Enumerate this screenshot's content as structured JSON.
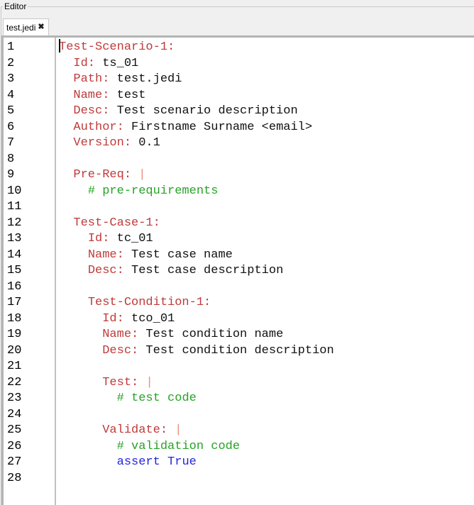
{
  "groupbox": {
    "title": "Editor"
  },
  "tabs": [
    {
      "label": "test.jedi",
      "close_icon": "close-icon",
      "active": true
    }
  ],
  "colors": {
    "key": "#c03a3a",
    "value": "#111111",
    "comment": "#26a326",
    "pipe": "#e8907a",
    "keyword": "#2424e0"
  },
  "editor": {
    "lines": [
      {
        "n": "1",
        "tokens": [
          {
            "t": "key",
            "s": "Test-Scenario-1:"
          }
        ],
        "caret": true
      },
      {
        "n": "2",
        "tokens": [
          {
            "t": "ws",
            "s": "  "
          },
          {
            "t": "key",
            "s": "Id:"
          },
          {
            "t": "val",
            "s": " ts_01"
          }
        ]
      },
      {
        "n": "3",
        "tokens": [
          {
            "t": "ws",
            "s": "  "
          },
          {
            "t": "key",
            "s": "Path:"
          },
          {
            "t": "val",
            "s": " test.jedi"
          }
        ]
      },
      {
        "n": "4",
        "tokens": [
          {
            "t": "ws",
            "s": "  "
          },
          {
            "t": "key",
            "s": "Name:"
          },
          {
            "t": "val",
            "s": " test"
          }
        ]
      },
      {
        "n": "5",
        "tokens": [
          {
            "t": "ws",
            "s": "  "
          },
          {
            "t": "key",
            "s": "Desc:"
          },
          {
            "t": "val",
            "s": " Test scenario description"
          }
        ]
      },
      {
        "n": "6",
        "tokens": [
          {
            "t": "ws",
            "s": "  "
          },
          {
            "t": "key",
            "s": "Author:"
          },
          {
            "t": "val",
            "s": " Firstname Surname <email>"
          }
        ]
      },
      {
        "n": "7",
        "tokens": [
          {
            "t": "ws",
            "s": "  "
          },
          {
            "t": "key",
            "s": "Version:"
          },
          {
            "t": "val",
            "s": " 0.1"
          }
        ]
      },
      {
        "n": "8",
        "tokens": []
      },
      {
        "n": "9",
        "tokens": [
          {
            "t": "ws",
            "s": "  "
          },
          {
            "t": "key",
            "s": "Pre-Req:"
          },
          {
            "t": "ws",
            "s": " "
          },
          {
            "t": "pipe",
            "s": "|"
          }
        ]
      },
      {
        "n": "10",
        "tokens": [
          {
            "t": "ws",
            "s": "    "
          },
          {
            "t": "comment",
            "s": "# pre-requirements"
          }
        ]
      },
      {
        "n": "11",
        "tokens": []
      },
      {
        "n": "12",
        "tokens": [
          {
            "t": "ws",
            "s": "  "
          },
          {
            "t": "key",
            "s": "Test-Case-1:"
          }
        ]
      },
      {
        "n": "13",
        "tokens": [
          {
            "t": "ws",
            "s": "    "
          },
          {
            "t": "key",
            "s": "Id:"
          },
          {
            "t": "val",
            "s": " tc_01"
          }
        ]
      },
      {
        "n": "14",
        "tokens": [
          {
            "t": "ws",
            "s": "    "
          },
          {
            "t": "key",
            "s": "Name:"
          },
          {
            "t": "val",
            "s": " Test case name"
          }
        ]
      },
      {
        "n": "15",
        "tokens": [
          {
            "t": "ws",
            "s": "    "
          },
          {
            "t": "key",
            "s": "Desc:"
          },
          {
            "t": "val",
            "s": " Test case description"
          }
        ]
      },
      {
        "n": "16",
        "tokens": []
      },
      {
        "n": "17",
        "tokens": [
          {
            "t": "ws",
            "s": "    "
          },
          {
            "t": "key",
            "s": "Test-Condition-1:"
          }
        ]
      },
      {
        "n": "18",
        "tokens": [
          {
            "t": "ws",
            "s": "      "
          },
          {
            "t": "key",
            "s": "Id:"
          },
          {
            "t": "val",
            "s": " tco_01"
          }
        ]
      },
      {
        "n": "19",
        "tokens": [
          {
            "t": "ws",
            "s": "      "
          },
          {
            "t": "key",
            "s": "Name:"
          },
          {
            "t": "val",
            "s": " Test condition name"
          }
        ]
      },
      {
        "n": "20",
        "tokens": [
          {
            "t": "ws",
            "s": "      "
          },
          {
            "t": "key",
            "s": "Desc:"
          },
          {
            "t": "val",
            "s": " Test condition description"
          }
        ]
      },
      {
        "n": "21",
        "tokens": []
      },
      {
        "n": "22",
        "tokens": [
          {
            "t": "ws",
            "s": "      "
          },
          {
            "t": "key",
            "s": "Test:"
          },
          {
            "t": "ws",
            "s": " "
          },
          {
            "t": "pipe",
            "s": "|"
          }
        ]
      },
      {
        "n": "23",
        "tokens": [
          {
            "t": "ws",
            "s": "        "
          },
          {
            "t": "comment",
            "s": "# test code"
          }
        ]
      },
      {
        "n": "24",
        "tokens": []
      },
      {
        "n": "25",
        "tokens": [
          {
            "t": "ws",
            "s": "      "
          },
          {
            "t": "key",
            "s": "Validate:"
          },
          {
            "t": "ws",
            "s": " "
          },
          {
            "t": "pipe",
            "s": "|"
          }
        ]
      },
      {
        "n": "26",
        "tokens": [
          {
            "t": "ws",
            "s": "        "
          },
          {
            "t": "comment",
            "s": "# validation code"
          }
        ]
      },
      {
        "n": "27",
        "tokens": [
          {
            "t": "ws",
            "s": "        "
          },
          {
            "t": "kw",
            "s": "assert"
          },
          {
            "t": "ws",
            "s": " "
          },
          {
            "t": "kw",
            "s": "True"
          }
        ]
      },
      {
        "n": "28",
        "tokens": []
      }
    ]
  }
}
